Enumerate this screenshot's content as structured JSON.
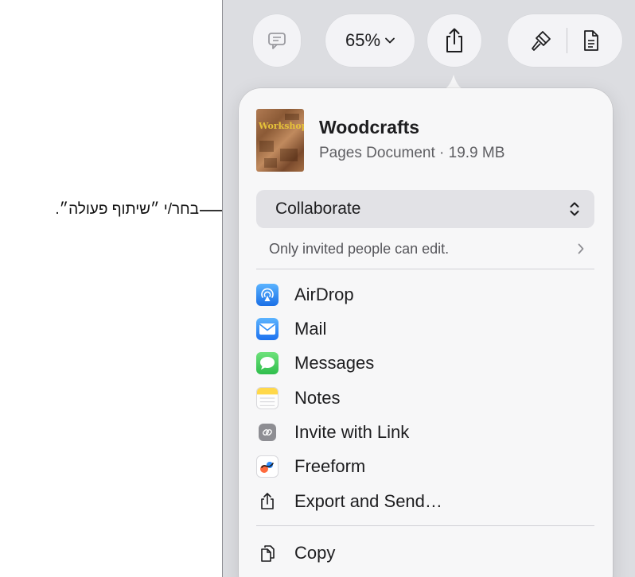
{
  "callout": {
    "text": "בחר/י ״שיתוף פעולה״."
  },
  "toolbar": {
    "zoom_label": "65%",
    "icons": [
      "comment-icon",
      "chevron-down-icon",
      "share-icon",
      "paintbrush-icon",
      "document-icon"
    ]
  },
  "share_sheet": {
    "document": {
      "title": "Woodcrafts",
      "meta": "Pages Document · 19.9 MB",
      "thumbnail_title": "Workshop"
    },
    "collaboration": {
      "selected": "Collaborate",
      "permissions": "Only invited people can edit."
    },
    "items": [
      {
        "label": "AirDrop",
        "icon": "airdrop-icon"
      },
      {
        "label": "Mail",
        "icon": "mail-icon"
      },
      {
        "label": "Messages",
        "icon": "messages-icon"
      },
      {
        "label": "Notes",
        "icon": "notes-icon"
      },
      {
        "label": "Invite with Link",
        "icon": "link-icon"
      },
      {
        "label": "Freeform",
        "icon": "freeform-icon"
      },
      {
        "label": "Export and Send…",
        "icon": "export-icon"
      }
    ],
    "secondary_items": [
      {
        "label": "Copy",
        "icon": "copy-icon"
      }
    ]
  },
  "colors": {
    "window_bg": "#dcdde1",
    "popover_bg": "#f7f7f8",
    "airdrop": "#1a8cff",
    "mail": "#2f8df6",
    "messages": "#34c759",
    "notes_yellow": "#ffd84a",
    "link_gray": "#8e8e93"
  }
}
